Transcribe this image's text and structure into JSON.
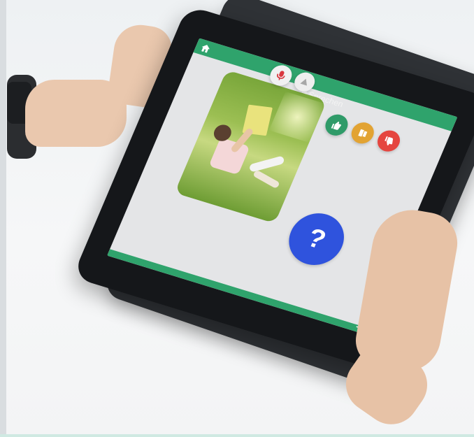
{
  "screen": {
    "tab_label": "Sprechen",
    "buttons": {
      "help_symbol": "?"
    }
  }
}
